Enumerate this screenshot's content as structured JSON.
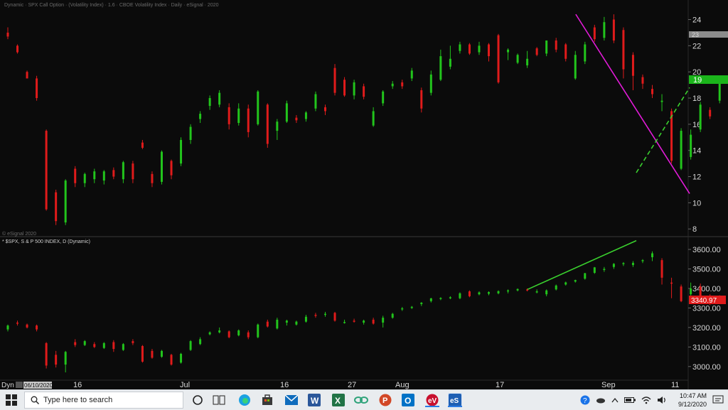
{
  "app": {
    "header_text": "Dynamic · SPX Call Option · (Volatility Index) · 1.6 · CBOE Volatility Index · Daily · eSignal · 2020",
    "copyright": "© eSignal 2020"
  },
  "upper_panel": {
    "name": "VIX (CBOE Volatility Index), Daily",
    "y_ticks": [
      "24",
      "22",
      "20",
      "18",
      "16",
      "14",
      "12",
      "10",
      "8"
    ],
    "last_price_tag": "19",
    "prior_tag": "23"
  },
  "lower_panel": {
    "label": "* $SPX, S & P 500 INDEX, D (Dynamic)",
    "y_ticks": [
      "3600.00",
      "3500.00",
      "3400.00",
      "3300.00",
      "3200.00",
      "3100.00",
      "3000.00"
    ],
    "last_price_tag": "3340.97"
  },
  "x_axis": {
    "dyn_label": "Dyn",
    "date_tag": "06/10/2020",
    "ticks": [
      "16",
      "Jul",
      "16",
      "27",
      "Aug",
      "17",
      "Sep",
      "11"
    ]
  },
  "colors": {
    "up": "#22c41c",
    "down": "#e01b1b",
    "background": "#0b0b0b",
    "magenta_trendline": "#e21bd8",
    "green_trendline": "#3ad12e"
  },
  "taskbar": {
    "search_placeholder": "Type here to search",
    "time": "10:47 AM",
    "date": "9/12/2020",
    "icons": [
      "cortana-icon",
      "edge-icon",
      "store-icon",
      "mail-icon",
      "word-icon",
      "excel-icon",
      "link-icon",
      "powerpoint-icon",
      "outlook-icon",
      "app-ev-icon",
      "esignal-icon"
    ]
  },
  "chart_data": [
    {
      "type": "candlestick",
      "title": "",
      "ylim": [
        7,
        25
      ],
      "y_ticks": [
        8,
        10,
        12,
        14,
        16,
        18,
        20,
        22,
        24
      ],
      "note": "VIX daily candles Jun 10 - Sep 11 2020",
      "candles": [
        {
          "o": 23.0,
          "h": 23.4,
          "l": 22.5,
          "c": 22.7
        },
        {
          "o": 22.0,
          "h": 22.1,
          "l": 21.4,
          "c": 21.5
        },
        {
          "o": 20.0,
          "h": 20.1,
          "l": 19.5,
          "c": 19.5
        },
        {
          "o": 19.5,
          "h": 19.7,
          "l": 17.8,
          "c": 18.0
        },
        {
          "o": 15.5,
          "h": 15.6,
          "l": 9.4,
          "c": 9.5
        },
        {
          "o": 10.8,
          "h": 11.0,
          "l": 8.3,
          "c": 8.6
        },
        {
          "o": 8.5,
          "h": 11.8,
          "l": 8.3,
          "c": 11.7
        },
        {
          "o": 12.6,
          "h": 12.8,
          "l": 11.2,
          "c": 11.5
        },
        {
          "o": 11.5,
          "h": 12.3,
          "l": 11.2,
          "c": 12.2
        },
        {
          "o": 11.8,
          "h": 12.6,
          "l": 11.5,
          "c": 12.4
        },
        {
          "o": 11.7,
          "h": 12.5,
          "l": 11.4,
          "c": 12.4
        },
        {
          "o": 12.5,
          "h": 12.7,
          "l": 11.8,
          "c": 12.0
        },
        {
          "o": 11.8,
          "h": 13.2,
          "l": 11.5,
          "c": 13.1
        },
        {
          "o": 13.0,
          "h": 13.2,
          "l": 11.5,
          "c": 11.8
        },
        {
          "o": 14.6,
          "h": 14.8,
          "l": 14.1,
          "c": 14.2
        },
        {
          "o": 12.2,
          "h": 12.4,
          "l": 11.2,
          "c": 11.5
        },
        {
          "o": 11.6,
          "h": 14.0,
          "l": 11.4,
          "c": 13.9
        },
        {
          "o": 13.2,
          "h": 13.3,
          "l": 11.8,
          "c": 12.1
        },
        {
          "o": 13.0,
          "h": 15.0,
          "l": 12.8,
          "c": 14.8
        },
        {
          "o": 14.8,
          "h": 16.0,
          "l": 14.5,
          "c": 15.8
        },
        {
          "o": 16.4,
          "h": 17.0,
          "l": 16.1,
          "c": 16.8
        },
        {
          "o": 17.4,
          "h": 18.2,
          "l": 17.1,
          "c": 18.0
        },
        {
          "o": 17.5,
          "h": 18.6,
          "l": 17.3,
          "c": 18.4
        },
        {
          "o": 17.3,
          "h": 17.6,
          "l": 15.6,
          "c": 16.0
        },
        {
          "o": 16.1,
          "h": 17.6,
          "l": 15.9,
          "c": 17.2
        },
        {
          "o": 17.2,
          "h": 17.5,
          "l": 15.0,
          "c": 15.4
        },
        {
          "o": 16.0,
          "h": 18.6,
          "l": 15.9,
          "c": 18.5
        },
        {
          "o": 17.5,
          "h": 17.6,
          "l": 14.2,
          "c": 14.5
        },
        {
          "o": 15.5,
          "h": 16.4,
          "l": 14.8,
          "c": 16.2
        },
        {
          "o": 16.2,
          "h": 17.8,
          "l": 16.1,
          "c": 17.6
        },
        {
          "o": 16.5,
          "h": 16.7,
          "l": 16.1,
          "c": 16.3
        },
        {
          "o": 16.4,
          "h": 17.0,
          "l": 16.2,
          "c": 16.9
        },
        {
          "o": 17.2,
          "h": 18.5,
          "l": 17.0,
          "c": 18.3
        },
        {
          "o": 17.3,
          "h": 17.5,
          "l": 16.7,
          "c": 17.0
        },
        {
          "o": 20.3,
          "h": 20.6,
          "l": 18.2,
          "c": 18.4
        },
        {
          "o": 19.4,
          "h": 19.6,
          "l": 18.1,
          "c": 18.2
        },
        {
          "o": 18.2,
          "h": 19.4,
          "l": 17.9,
          "c": 19.2
        },
        {
          "o": 18.9,
          "h": 19.1,
          "l": 17.9,
          "c": 18.1
        },
        {
          "o": 15.9,
          "h": 17.3,
          "l": 15.8,
          "c": 17.0
        },
        {
          "o": 17.6,
          "h": 18.6,
          "l": 17.4,
          "c": 18.5
        },
        {
          "o": 18.9,
          "h": 19.3,
          "l": 18.7,
          "c": 19.1
        },
        {
          "o": 19.2,
          "h": 19.4,
          "l": 18.7,
          "c": 18.9
        },
        {
          "o": 19.5,
          "h": 20.3,
          "l": 19.3,
          "c": 20.1
        },
        {
          "o": 18.6,
          "h": 18.8,
          "l": 16.9,
          "c": 17.2
        },
        {
          "o": 18.4,
          "h": 20.1,
          "l": 18.2,
          "c": 19.8
        },
        {
          "o": 19.4,
          "h": 21.7,
          "l": 19.3,
          "c": 21.2
        },
        {
          "o": 20.4,
          "h": 22.0,
          "l": 20.2,
          "c": 21.0
        },
        {
          "o": 21.6,
          "h": 22.3,
          "l": 21.4,
          "c": 22.1
        },
        {
          "o": 22.1,
          "h": 22.2,
          "l": 21.3,
          "c": 21.4
        },
        {
          "o": 21.5,
          "h": 22.3,
          "l": 21.3,
          "c": 22.0
        },
        {
          "o": 22.1,
          "h": 22.2,
          "l": 20.8,
          "c": 21.2
        },
        {
          "o": 22.8,
          "h": 22.9,
          "l": 19.1,
          "c": 19.2
        },
        {
          "o": 21.5,
          "h": 21.8,
          "l": 20.9,
          "c": 21.7
        },
        {
          "o": 20.7,
          "h": 21.4,
          "l": 20.6,
          "c": 21.3
        },
        {
          "o": 20.5,
          "h": 21.6,
          "l": 20.3,
          "c": 21.0
        },
        {
          "o": 21.8,
          "h": 21.9,
          "l": 21.2,
          "c": 21.3
        },
        {
          "o": 21.4,
          "h": 22.4,
          "l": 21.2,
          "c": 22.4
        },
        {
          "o": 22.4,
          "h": 22.6,
          "l": 21.5,
          "c": 21.7
        },
        {
          "o": 22.1,
          "h": 22.2,
          "l": 20.8,
          "c": 21.0
        },
        {
          "o": 19.5,
          "h": 21.6,
          "l": 19.4,
          "c": 21.3
        },
        {
          "o": 20.8,
          "h": 22.3,
          "l": 20.6,
          "c": 22.1
        },
        {
          "o": 23.4,
          "h": 23.6,
          "l": 22.3,
          "c": 22.5
        },
        {
          "o": 22.6,
          "h": 24.2,
          "l": 22.4,
          "c": 23.8
        },
        {
          "o": 24.0,
          "h": 24.4,
          "l": 22.2,
          "c": 22.4
        },
        {
          "o": 23.2,
          "h": 23.4,
          "l": 19.5,
          "c": 20.2
        },
        {
          "o": 21.3,
          "h": 21.5,
          "l": 18.6,
          "c": 19.7
        },
        {
          "o": 19.6,
          "h": 19.8,
          "l": 18.7,
          "c": 19.1
        },
        {
          "o": 18.7,
          "h": 19.0,
          "l": 18.0,
          "c": 18.3
        },
        {
          "o": 17.7,
          "h": 18.3,
          "l": 17.0,
          "c": 17.8
        },
        {
          "o": 17.0,
          "h": 17.2,
          "l": 13.0,
          "c": 13.2
        },
        {
          "o": 12.6,
          "h": 15.7,
          "l": 12.5,
          "c": 15.5
        },
        {
          "o": 13.5,
          "h": 15.6,
          "l": 13.3,
          "c": 15.2
        },
        {
          "o": 15.6,
          "h": 17.7,
          "l": 15.4,
          "c": 17.5
        },
        {
          "o": 17.1,
          "h": 17.3,
          "l": 16.4,
          "c": 16.6
        },
        {
          "o": 17.8,
          "h": 19.3,
          "l": 17.6,
          "c": 19.1
        }
      ],
      "trendlines": [
        {
          "name": "magenta-down",
          "from": [
            62,
            24.4
          ],
          "to": [
            75,
            10.7
          ]
        },
        {
          "name": "green-up",
          "from": [
            69.5,
            12.3
          ],
          "to": [
            75,
            18.8
          ]
        }
      ]
    },
    {
      "type": "candlestick",
      "title": "* $SPX, S & P 500 INDEX, D (Dynamic)",
      "ylim": [
        2960,
        3640
      ],
      "y_ticks": [
        3000,
        3100,
        3200,
        3300,
        3400,
        3500,
        3600
      ],
      "candles": [
        {
          "o": 3190,
          "h": 3215,
          "l": 3180,
          "c": 3210
        },
        {
          "o": 3225,
          "h": 3235,
          "l": 3210,
          "c": 3220
        },
        {
          "o": 3215,
          "h": 3220,
          "l": 3195,
          "c": 3200
        },
        {
          "o": 3210,
          "h": 3215,
          "l": 3180,
          "c": 3190
        },
        {
          "o": 3120,
          "h": 3125,
          "l": 2990,
          "c": 3005
        },
        {
          "o": 3060,
          "h": 3080,
          "l": 2995,
          "c": 3010
        },
        {
          "o": 3010,
          "h": 3080,
          "l": 2970,
          "c": 3075
        },
        {
          "o": 3125,
          "h": 3140,
          "l": 3100,
          "c": 3110
        },
        {
          "o": 3110,
          "h": 3135,
          "l": 3105,
          "c": 3130
        },
        {
          "o": 3115,
          "h": 3125,
          "l": 3095,
          "c": 3100
        },
        {
          "o": 3095,
          "h": 3125,
          "l": 3090,
          "c": 3120
        },
        {
          "o": 3125,
          "h": 3135,
          "l": 3075,
          "c": 3090
        },
        {
          "o": 3085,
          "h": 3120,
          "l": 3080,
          "c": 3115
        },
        {
          "o": 3130,
          "h": 3140,
          "l": 3110,
          "c": 3120
        },
        {
          "o": 3105,
          "h": 3110,
          "l": 3020,
          "c": 3025
        },
        {
          "o": 3080,
          "h": 3090,
          "l": 3040,
          "c": 3045
        },
        {
          "o": 3050,
          "h": 3085,
          "l": 3045,
          "c": 3080
        },
        {
          "o": 3060,
          "h": 3065,
          "l": 3005,
          "c": 3010
        },
        {
          "o": 3020,
          "h": 3070,
          "l": 3015,
          "c": 3065
        },
        {
          "o": 3085,
          "h": 3135,
          "l": 3080,
          "c": 3130
        },
        {
          "o": 3115,
          "h": 3150,
          "l": 3110,
          "c": 3140
        },
        {
          "o": 3165,
          "h": 3180,
          "l": 3160,
          "c": 3175
        },
        {
          "o": 3175,
          "h": 3200,
          "l": 3170,
          "c": 3185
        },
        {
          "o": 3180,
          "h": 3185,
          "l": 3145,
          "c": 3150
        },
        {
          "o": 3160,
          "h": 3190,
          "l": 3155,
          "c": 3185
        },
        {
          "o": 3175,
          "h": 3185,
          "l": 3140,
          "c": 3150
        },
        {
          "o": 3150,
          "h": 3220,
          "l": 3145,
          "c": 3215
        },
        {
          "o": 3230,
          "h": 3240,
          "l": 3200,
          "c": 3205
        },
        {
          "o": 3195,
          "h": 3250,
          "l": 3190,
          "c": 3240
        },
        {
          "o": 3225,
          "h": 3240,
          "l": 3210,
          "c": 3235
        },
        {
          "o": 3215,
          "h": 3235,
          "l": 3210,
          "c": 3230
        },
        {
          "o": 3230,
          "h": 3265,
          "l": 3225,
          "c": 3255
        },
        {
          "o": 3265,
          "h": 3275,
          "l": 3250,
          "c": 3260
        },
        {
          "o": 3270,
          "h": 3280,
          "l": 3255,
          "c": 3270
        },
        {
          "o": 3275,
          "h": 3280,
          "l": 3230,
          "c": 3235
        },
        {
          "o": 3225,
          "h": 3240,
          "l": 3220,
          "c": 3228
        },
        {
          "o": 3235,
          "h": 3245,
          "l": 3225,
          "c": 3230
        },
        {
          "o": 3225,
          "h": 3240,
          "l": 3215,
          "c": 3235
        },
        {
          "o": 3240,
          "h": 3250,
          "l": 3215,
          "c": 3220
        },
        {
          "o": 3225,
          "h": 3260,
          "l": 3200,
          "c": 3250
        },
        {
          "o": 3250,
          "h": 3275,
          "l": 3245,
          "c": 3270
        },
        {
          "o": 3295,
          "h": 3305,
          "l": 3285,
          "c": 3298
        },
        {
          "o": 3300,
          "h": 3310,
          "l": 3295,
          "c": 3306
        },
        {
          "o": 3320,
          "h": 3330,
          "l": 3310,
          "c": 3327
        },
        {
          "o": 3335,
          "h": 3352,
          "l": 3328,
          "c": 3349
        },
        {
          "o": 3350,
          "h": 3355,
          "l": 3340,
          "c": 3351
        },
        {
          "o": 3355,
          "h": 3360,
          "l": 3345,
          "c": 3355
        },
        {
          "o": 3350,
          "h": 3380,
          "l": 3345,
          "c": 3375
        },
        {
          "o": 3385,
          "h": 3390,
          "l": 3355,
          "c": 3360
        },
        {
          "o": 3370,
          "h": 3385,
          "l": 3365,
          "c": 3380
        },
        {
          "o": 3373,
          "h": 3385,
          "l": 3365,
          "c": 3381
        },
        {
          "o": 3375,
          "h": 3390,
          "l": 3370,
          "c": 3386
        },
        {
          "o": 3385,
          "h": 3395,
          "l": 3375,
          "c": 3390
        },
        {
          "o": 3390,
          "h": 3400,
          "l": 3385,
          "c": 3397
        },
        {
          "o": 3395,
          "h": 3400,
          "l": 3385,
          "c": 3390
        },
        {
          "o": 3380,
          "h": 3395,
          "l": 3375,
          "c": 3385
        },
        {
          "o": 3370,
          "h": 3395,
          "l": 3360,
          "c": 3390
        },
        {
          "o": 3395,
          "h": 3420,
          "l": 3390,
          "c": 3415
        },
        {
          "o": 3420,
          "h": 3435,
          "l": 3415,
          "c": 3431
        },
        {
          "o": 3435,
          "h": 3445,
          "l": 3430,
          "c": 3443
        },
        {
          "o": 3450,
          "h": 3480,
          "l": 3445,
          "c": 3478
        },
        {
          "o": 3480,
          "h": 3510,
          "l": 3475,
          "c": 3508
        },
        {
          "o": 3500,
          "h": 3510,
          "l": 3485,
          "c": 3500
        },
        {
          "o": 3510,
          "h": 3530,
          "l": 3500,
          "c": 3526
        },
        {
          "o": 3525,
          "h": 3535,
          "l": 3515,
          "c": 3530
        },
        {
          "o": 3520,
          "h": 3540,
          "l": 3510,
          "c": 3531
        },
        {
          "o": 3540,
          "h": 3550,
          "l": 3530,
          "c": 3545
        },
        {
          "o": 3560,
          "h": 3590,
          "l": 3540,
          "c": 3580
        },
        {
          "o": 3545,
          "h": 3555,
          "l": 3420,
          "c": 3455
        },
        {
          "o": 3430,
          "h": 3455,
          "l": 3350,
          "c": 3425
        },
        {
          "o": 3410,
          "h": 3420,
          "l": 3330,
          "c": 3335
        },
        {
          "o": 3370,
          "h": 3430,
          "l": 3360,
          "c": 3400
        },
        {
          "o": 3410,
          "h": 3425,
          "l": 3335,
          "c": 3340
        },
        {
          "o": 3350,
          "h": 3370,
          "l": 3315,
          "c": 3340
        },
        {
          "o": 3355,
          "h": 3365,
          "l": 3320,
          "c": 3341
        }
      ],
      "trendlines": [
        {
          "name": "green-up",
          "from": [
            55,
            3395
          ],
          "to": [
            66,
            3645
          ]
        }
      ]
    }
  ]
}
